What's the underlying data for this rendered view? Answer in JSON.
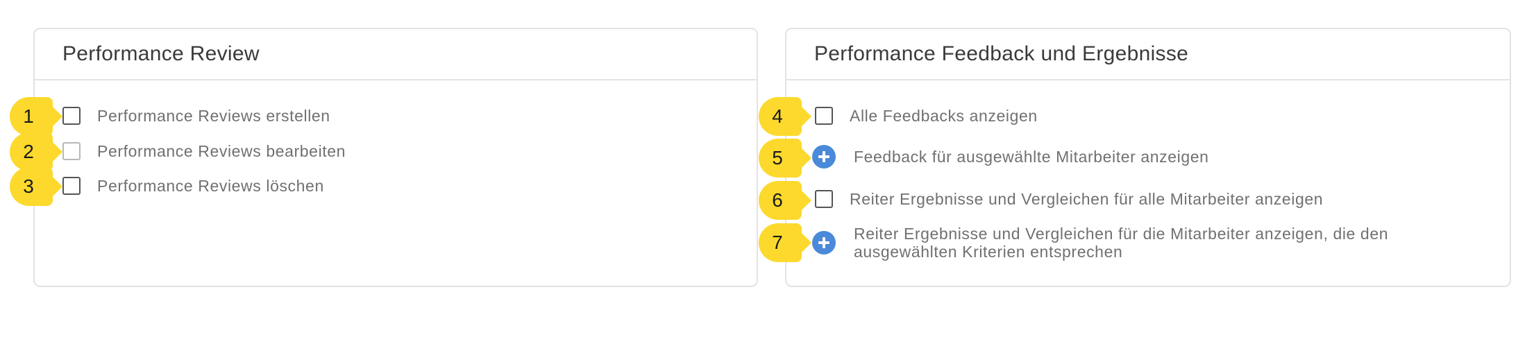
{
  "left_panel": {
    "title": "Performance Review",
    "items": [
      {
        "badge": "1",
        "label": "Performance Reviews erstellen"
      },
      {
        "badge": "2",
        "label": "Performance Reviews bearbeiten"
      },
      {
        "badge": "3",
        "label": "Performance Reviews löschen"
      }
    ]
  },
  "right_panel": {
    "title": "Performance Feedback und Ergebnisse",
    "items": [
      {
        "badge": "4",
        "label": "Alle Feedbacks anzeigen",
        "control": "checkbox"
      },
      {
        "badge": "5",
        "label": "Feedback für ausgewählte Mitarbeiter anzeigen",
        "control": "plus-circle-icon"
      },
      {
        "badge": "6",
        "label": "Reiter Ergebnisse und Vergleichen für alle Mitarbeiter anzeigen",
        "control": "checkbox"
      },
      {
        "badge": "7",
        "label_line1": "Reiter Ergebnisse und Vergleichen für die Mitarbeiter anzeigen, die den",
        "label_line2": "ausgewählten Kriterien entsprechen",
        "control": "plus-circle-icon"
      }
    ]
  },
  "colors": {
    "badge": "#fcd92c",
    "accent": "#4a8ad8",
    "border": "#e3e3e3"
  }
}
